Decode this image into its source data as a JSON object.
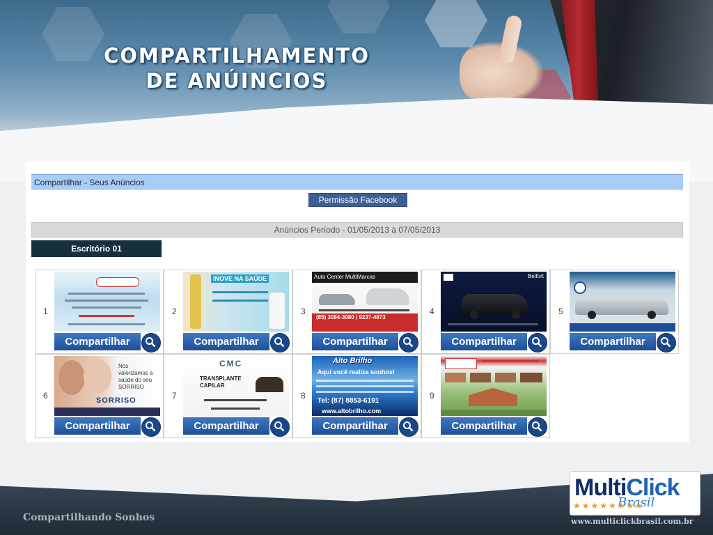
{
  "slide": {
    "title_line1": "COMPARTILHAMENTO",
    "title_line2": "DE ANÚINCIOS",
    "footer_left": "Compartilhando Sonhos",
    "footer_url": "www.multiclickbrasil.com.br",
    "logo": {
      "word1": "Multi",
      "word2": "Click",
      "sub": "Brasil",
      "stars": "★★★★★★★★"
    }
  },
  "screen": {
    "header": "Compartilhar - Seus Anúncios",
    "facebook_button": "Permissão Facebook",
    "period": "Anúncios Período - 01/05/2013 à 07/05/2013",
    "office": "Escritório 01",
    "share_label": "Compartilhar",
    "ads": [
      {
        "num": "1"
      },
      {
        "num": "2"
      },
      {
        "num": "3"
      },
      {
        "num": "4"
      },
      {
        "num": "5"
      },
      {
        "num": "6"
      },
      {
        "num": "7"
      },
      {
        "num": "8"
      },
      {
        "num": "9"
      }
    ],
    "ad_texts": {
      "ad2_heading": "INOVE NA SAÚDE",
      "ad3_brand": "Auto Center MultiMarcas",
      "ad3_phone": "(85) 3084-3080 | 9237-4873",
      "ad4_brand": "Belfort",
      "ad6_text": "Nós valorizamos a saúde do seu SORRISO",
      "ad6_brand": "SORRISO",
      "ad7_brand": "CMC",
      "ad7_text": "TRANSPLANTE CAPILAR",
      "ad8_brand": "Alto Brilho",
      "ad8_slogan": "Aqui você realiza sonhos!",
      "ad8_phone": "Tel: (87) 8853-6191",
      "ad8_url": "www.altobrilho.com"
    }
  }
}
